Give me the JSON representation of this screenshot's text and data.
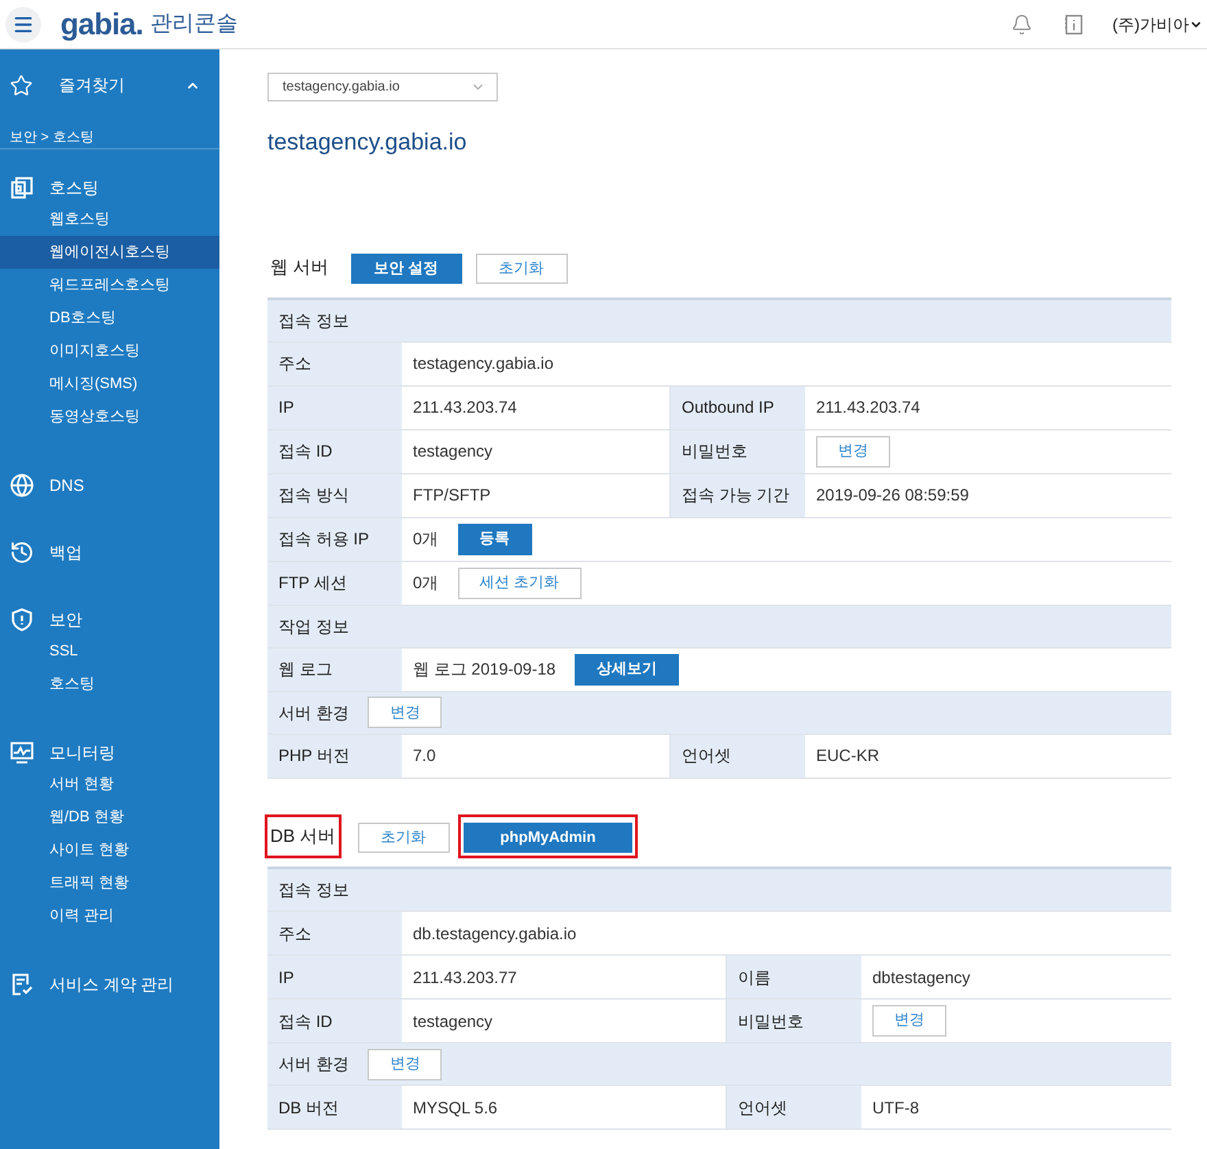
{
  "header": {
    "logo": "gabia.",
    "app_title": "관리콘솔",
    "account": "(주)가비아"
  },
  "sidebar": {
    "favorites": {
      "title": "즐겨찾기",
      "expanded": true,
      "breadcrumb": "보안 > 호스팅"
    },
    "groups": [
      {
        "title": "호스팅",
        "items": [
          {
            "label": "웹호스팅",
            "selected": false
          },
          {
            "label": "웹에이전시호스팅",
            "selected": true
          },
          {
            "label": "워드프레스호스팅",
            "selected": false
          },
          {
            "label": "DB호스팅",
            "selected": false
          },
          {
            "label": "이미지호스팅",
            "selected": false
          },
          {
            "label": "메시징(SMS)",
            "selected": false
          },
          {
            "label": "동영상호스팅",
            "selected": false
          }
        ]
      },
      {
        "title": "DNS"
      },
      {
        "title": "백업"
      },
      {
        "title": "보안",
        "items": [
          {
            "label": "SSL",
            "selected": false
          },
          {
            "label": "호스팅",
            "selected": false
          }
        ]
      },
      {
        "title": "모니터링",
        "items": [
          {
            "label": "서버 현황",
            "selected": false
          },
          {
            "label": "웹/DB 현황",
            "selected": false
          },
          {
            "label": "사이트 현황",
            "selected": false
          },
          {
            "label": "트래픽 현황",
            "selected": false
          },
          {
            "label": "이력 관리",
            "selected": false
          }
        ]
      },
      {
        "title": "서비스 계약 관리"
      }
    ]
  },
  "domain_select": {
    "value": "testagency.gabia.io"
  },
  "page_title": "testagency.gabia.io",
  "servers": [
    {
      "title": "웹 서버",
      "highlighted": false,
      "buttons": [
        {
          "label": "보안 설정",
          "kind": "primary",
          "highlighted": false
        },
        {
          "label": "초기화",
          "kind": "outline",
          "highlighted": false
        }
      ],
      "rows": [
        {
          "kind": "section",
          "label": "접속 정보"
        },
        {
          "kind": "cells",
          "cells": [
            {
              "label": "주소",
              "value": "testagency.gabia.io"
            }
          ]
        },
        {
          "kind": "cells",
          "cells": [
            {
              "label": "IP",
              "value": "211.43.203.74"
            },
            {
              "label": "Outbound IP",
              "value": "211.43.203.74"
            }
          ]
        },
        {
          "kind": "cells",
          "cells": [
            {
              "label": "접속 ID",
              "value": "testagency"
            },
            {
              "label": "비밀번호",
              "button": {
                "label": "변경",
                "kind": "outline"
              }
            }
          ]
        },
        {
          "kind": "cells",
          "cells": [
            {
              "label": "접속 방식",
              "value": "FTP/SFTP"
            },
            {
              "label": "접속 가능 기간",
              "value": "2019-09-26 08:59:59"
            }
          ]
        },
        {
          "kind": "cells",
          "cells": [
            {
              "label": "접속 허용 IP",
              "value": "0개",
              "button": {
                "label": "등록",
                "kind": "primary"
              }
            }
          ]
        },
        {
          "kind": "cells",
          "cells": [
            {
              "label": "FTP 세션",
              "value": "0개",
              "button": {
                "label": "세션 초기화",
                "kind": "outline"
              }
            }
          ]
        },
        {
          "kind": "section",
          "label": "작업 정보"
        },
        {
          "kind": "cells",
          "cells": [
            {
              "label": "웹 로그",
              "value": "웹 로그 2019-09-18",
              "button": {
                "label": "상세보기",
                "kind": "primary"
              }
            }
          ]
        },
        {
          "kind": "section",
          "label": "서버 환경",
          "button": {
            "label": "변경",
            "kind": "outline"
          }
        },
        {
          "kind": "cells",
          "cells": [
            {
              "label": "PHP 버전",
              "value": "7.0"
            },
            {
              "label": "언어셋",
              "value": "EUC-KR"
            }
          ]
        }
      ]
    },
    {
      "title": "DB 서버",
      "highlighted": true,
      "buttons": [
        {
          "label": "초기화",
          "kind": "outline",
          "highlighted": false
        },
        {
          "label": "phpMyAdmin",
          "kind": "primary",
          "highlighted": true
        }
      ],
      "rows": [
        {
          "kind": "section",
          "label": "접속 정보"
        },
        {
          "kind": "cells",
          "cells": [
            {
              "label": "주소",
              "value": "db.testagency.gabia.io"
            }
          ]
        },
        {
          "kind": "cells",
          "cells": [
            {
              "label": "IP",
              "value": "211.43.203.77"
            },
            {
              "label": "이름",
              "value": "dbtestagency"
            }
          ]
        },
        {
          "kind": "cells",
          "cells": [
            {
              "label": "접속 ID",
              "value": "testagency"
            },
            {
              "label": "비밀번호",
              "button": {
                "label": "변경",
                "kind": "outline"
              }
            }
          ]
        },
        {
          "kind": "section",
          "label": "서버 환경",
          "button": {
            "label": "변경",
            "kind": "outline"
          }
        },
        {
          "kind": "cells",
          "cells": [
            {
              "label": "DB 버전",
              "value": "MYSQL 5.6"
            },
            {
              "label": "언어셋",
              "value": "UTF-8"
            }
          ]
        }
      ]
    }
  ]
}
